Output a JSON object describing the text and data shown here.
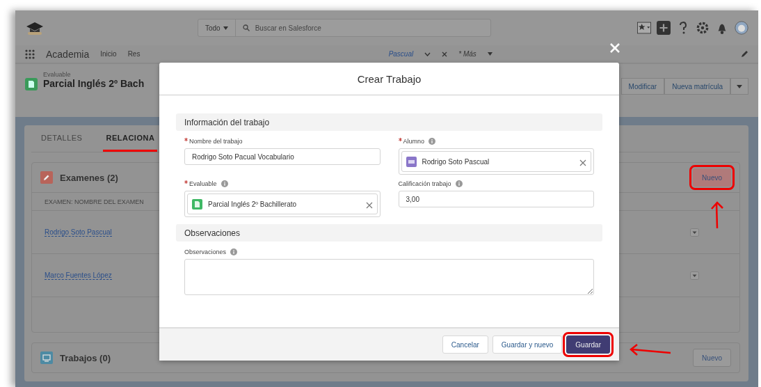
{
  "app": {
    "name": "Academia",
    "search_scope": "Todo",
    "search_placeholder": "Buscar en Salesforce"
  },
  "nav": [
    {
      "label": "Inicio",
      "kind": "link"
    },
    {
      "label": "Res",
      "kind": "link"
    },
    {
      "label": "Pascual",
      "kind": "tab"
    },
    {
      "label": "* Más",
      "kind": "more"
    }
  ],
  "record": {
    "type_label": "Evaluable",
    "title": "Parcial Inglés 2º Bach",
    "actions": [
      "Modificar",
      "Nueva matrícula"
    ]
  },
  "tabs": [
    {
      "label": "DETALLES",
      "selected": false
    },
    {
      "label": "RELACIONA",
      "selected": true
    }
  ],
  "related_lists": [
    {
      "title": "Examenes (2)",
      "button": {
        "label": "Nuevo",
        "highlighted": true
      },
      "column": "EXAMEN: NOMBRE DEL EXAMEN",
      "rows": [
        "Rodrigo Soto Pascual",
        "Marco Fuentes López"
      ]
    },
    {
      "title": "Trabajos (0)",
      "button": {
        "label": "Nuevo",
        "highlighted": false
      }
    }
  ],
  "modal": {
    "title": "Crear Trabajo",
    "sections": [
      {
        "title": "Información del trabajo",
        "fields": [
          {
            "kind": "text",
            "label": "Nombre del trabajo",
            "required": true,
            "info": false,
            "value": "Rodrigo Soto Pacual Vocabulario"
          },
          {
            "kind": "lookup",
            "label": "Alumno",
            "required": true,
            "info": true,
            "value": "Rodrigo Soto Pascual"
          },
          {
            "kind": "lookup",
            "label": "Evaluable",
            "required": true,
            "info": true,
            "value": "Parcial Inglés 2º Bachillerato"
          },
          {
            "kind": "text",
            "label": "Calificación trabajo",
            "required": false,
            "info": true,
            "value": "3,00"
          }
        ]
      },
      {
        "title": "Observaciones",
        "fields": [
          {
            "kind": "textarea",
            "label": "Observaciones",
            "required": false,
            "info": true
          }
        ]
      }
    ],
    "buttons": [
      {
        "label": "Cancelar",
        "kind": "neutral",
        "highlighted": false
      },
      {
        "label": "Guardar y nuevo",
        "kind": "neutral",
        "highlighted": false
      },
      {
        "label": "Guardar",
        "kind": "brand",
        "highlighted": true
      }
    ]
  }
}
